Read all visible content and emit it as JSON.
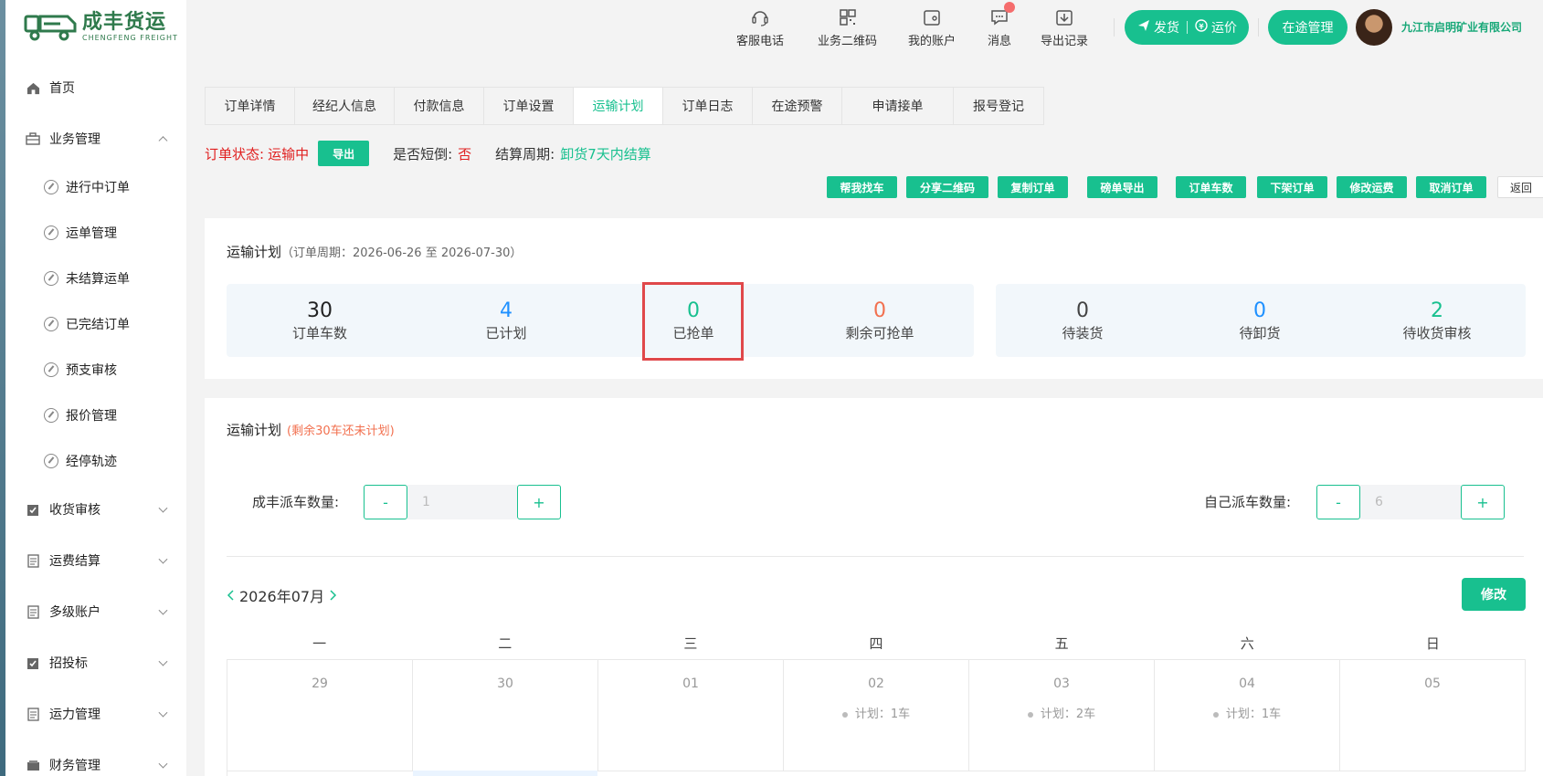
{
  "brand": {
    "name_cn": "成丰货运",
    "name_en": "CHENGFENG FREIGHT",
    "accent": "#18c08f"
  },
  "sidebar": {
    "items": [
      {
        "label": "首页",
        "icon": "home-icon"
      },
      {
        "label": "业务管理",
        "icon": "briefcase-icon",
        "expanded": true
      },
      {
        "label": "收货审核",
        "icon": "check-doc-icon"
      },
      {
        "label": "运费结算",
        "icon": "doc-icon"
      },
      {
        "label": "多级账户",
        "icon": "doc-icon"
      },
      {
        "label": "招投标",
        "icon": "check-doc-icon"
      },
      {
        "label": "运力管理",
        "icon": "doc-icon"
      },
      {
        "label": "财务管理",
        "icon": "wallet-icon"
      }
    ],
    "sub_items": [
      "进行中订单",
      "运单管理",
      "未结算运单",
      "已完结订单",
      "预支审核",
      "报价管理",
      "经停轨迹"
    ]
  },
  "header": {
    "tools": [
      {
        "label": "客服电话",
        "icon": "headset-icon"
      },
      {
        "label": "业务二维码",
        "icon": "qrcode-icon"
      },
      {
        "label": "我的账户",
        "icon": "wallet-icon"
      },
      {
        "label": "消息",
        "icon": "message-icon"
      },
      {
        "label": "导出记录",
        "icon": "download-icon"
      }
    ],
    "ship_label": "发货",
    "price_label": "运价",
    "transit_label": "在途管理",
    "company": "九江市启明矿业有限公司"
  },
  "tabs": [
    "订单详情",
    "经纪人信息",
    "付款信息",
    "订单设置",
    "运输计划",
    "订单日志",
    "在途预警",
    "申请接单",
    "报号登记"
  ],
  "active_tab": "运输计划",
  "status": {
    "order_status_label": "订单状态:",
    "order_status_value": "运输中",
    "export_label": "导出",
    "short_label": "是否短倒:",
    "short_value": "否",
    "cycle_label": "结算周期:",
    "cycle_value": "卸货7天内结算"
  },
  "actions": [
    "帮我找车",
    "分享二维码",
    "复制订单",
    "磅单导出",
    "订单车数",
    "下架订单",
    "修改运费",
    "取消订单",
    "返回"
  ],
  "plan_summary": {
    "title": "运输计划",
    "period": "（订单周期：2026-06-26 至 2026-07-30）",
    "stats": [
      {
        "value": "30",
        "label": "订单车数",
        "color": "#222222"
      },
      {
        "value": "4",
        "label": "已计划",
        "color": "#1e90ff"
      },
      {
        "value": "0",
        "label": "已抢单",
        "color": "#18c08f"
      },
      {
        "value": "0",
        "label": "剩余可抢单",
        "color": "#f2704f"
      },
      {
        "value": "0",
        "label": "待装货",
        "color": "#444444"
      },
      {
        "value": "0",
        "label": "待卸货",
        "color": "#1e90ff"
      },
      {
        "value": "2",
        "label": "待收货审核",
        "color": "#18c08f"
      }
    ]
  },
  "plan_detail": {
    "title": "运输计划",
    "remaining": "(剩余30车还未计划)",
    "cf_label": "成丰派车数量:",
    "cf_value": "1",
    "self_label": "自己派车数量:",
    "self_value": "6",
    "minus": "-",
    "plus": "+",
    "month": "2026年07月",
    "edit_label": "修改",
    "weekdays": [
      "一",
      "二",
      "三",
      "四",
      "五",
      "六",
      "日"
    ],
    "days": [
      {
        "date": "29",
        "plan": ""
      },
      {
        "date": "30",
        "plan": ""
      },
      {
        "date": "01",
        "plan": ""
      },
      {
        "date": "02",
        "plan": "计划：1车"
      },
      {
        "date": "03",
        "plan": "计划：2车"
      },
      {
        "date": "04",
        "plan": "计划：1车"
      },
      {
        "date": "05",
        "plan": ""
      }
    ]
  }
}
